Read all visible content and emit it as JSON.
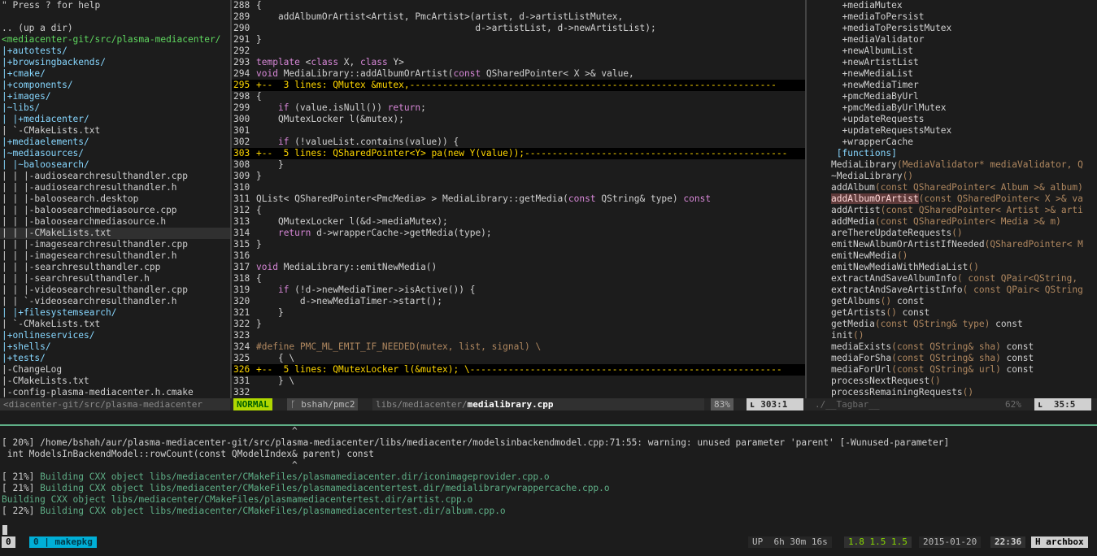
{
  "nerdtree": {
    "lines": [
      {
        "text": "\" Press ? for help",
        "cls": "t-help"
      },
      {
        "text": "",
        "cls": "t-file"
      },
      {
        "text": ".. (up a dir)",
        "cls": "t-up"
      },
      {
        "text": "<mediacenter-git/src/plasma-mediacenter/",
        "cls": "t-root"
      },
      {
        "text": "|+autotests/",
        "cls": "t-dir"
      },
      {
        "text": "|+browsingbackends/",
        "cls": "t-dir"
      },
      {
        "text": "|+cmake/",
        "cls": "t-dir"
      },
      {
        "text": "|+components/",
        "cls": "t-dir"
      },
      {
        "text": "|+images/",
        "cls": "t-dir"
      },
      {
        "text": "|~libs/",
        "cls": "t-dir"
      },
      {
        "text": "| |+mediacenter/",
        "cls": "t-dir"
      },
      {
        "text": "| `-CMakeLists.txt",
        "cls": "t-file"
      },
      {
        "text": "|+mediaelements/",
        "cls": "t-dir"
      },
      {
        "text": "|~mediasources/",
        "cls": "t-dir"
      },
      {
        "text": "| |~baloosearch/",
        "cls": "t-dir"
      },
      {
        "text": "| | |-audiosearchresulthandler.cpp",
        "cls": "t-file"
      },
      {
        "text": "| | |-audiosearchresulthandler.h",
        "cls": "t-file"
      },
      {
        "text": "| | |-baloosearch.desktop",
        "cls": "t-file"
      },
      {
        "text": "| | |-baloosearchmediasource.cpp",
        "cls": "t-file"
      },
      {
        "text": "| | |-baloosearchmediasource.h",
        "cls": "t-file"
      },
      {
        "text": "| | |-CMakeLists.txt",
        "cls": "t-file t-cur"
      },
      {
        "text": "| | |-imagesearchresulthandler.cpp",
        "cls": "t-file"
      },
      {
        "text": "| | |-imagesearchresulthandler.h",
        "cls": "t-file"
      },
      {
        "text": "| | |-searchresulthandler.cpp",
        "cls": "t-file"
      },
      {
        "text": "| | |-searchresulthandler.h",
        "cls": "t-file"
      },
      {
        "text": "| | |-videosearchresulthandler.cpp",
        "cls": "t-file"
      },
      {
        "text": "| | `-videosearchresulthandler.h",
        "cls": "t-file"
      },
      {
        "text": "| |+filesystemsearch/",
        "cls": "t-dir"
      },
      {
        "text": "| `-CMakeLists.txt",
        "cls": "t-file"
      },
      {
        "text": "|+onlineservices/",
        "cls": "t-dir"
      },
      {
        "text": "|+shells/",
        "cls": "t-dir"
      },
      {
        "text": "|+tests/",
        "cls": "t-dir"
      },
      {
        "text": "|-ChangeLog",
        "cls": "t-file"
      },
      {
        "text": "|-CMakeLists.txt",
        "cls": "t-file"
      },
      {
        "text": "|-config-plasma-mediacenter.h.cmake",
        "cls": "t-file"
      }
    ]
  },
  "code": {
    "lines": [
      {
        "n": "288",
        "t": "{",
        "fold": false
      },
      {
        "n": "289",
        "t": "    addAlbumOrArtist<Artist, PmcArtist>(artist, d->artistListMutex,",
        "fold": false
      },
      {
        "n": "290",
        "t": "                                        d->artistList, d->newArtistList);",
        "fold": false
      },
      {
        "n": "291",
        "t": "}",
        "fold": false
      },
      {
        "n": "292",
        "t": "",
        "fold": false
      },
      {
        "n": "293",
        "t": "template <class X, class Y>",
        "fold": false
      },
      {
        "n": "294",
        "t": "void MediaLibrary::addAlbumOrArtist(const QSharedPointer< X >& value,",
        "fold": false
      },
      {
        "n": "295",
        "t": "+--  3 lines: QMutex &mutex,-------------------------------------------------------------------",
        "fold": true
      },
      {
        "n": "298",
        "t": "{",
        "fold": false
      },
      {
        "n": "299",
        "t": "    if (value.isNull()) return;",
        "fold": false
      },
      {
        "n": "300",
        "t": "    QMutexLocker l(&mutex);",
        "fold": false
      },
      {
        "n": "301",
        "t": "",
        "fold": false
      },
      {
        "n": "302",
        "t": "    if (!valueList.contains(value)) {",
        "fold": false
      },
      {
        "n": "303",
        "t": "+--  5 lines: QSharedPointer<Y> pa(new Y(value));------------------------------------------------",
        "fold": true
      },
      {
        "n": "308",
        "t": "    }",
        "fold": false
      },
      {
        "n": "309",
        "t": "}",
        "fold": false
      },
      {
        "n": "310",
        "t": "",
        "fold": false
      },
      {
        "n": "311",
        "t": "QList< QSharedPointer<PmcMedia> > MediaLibrary::getMedia(const QString& type) const",
        "fold": false
      },
      {
        "n": "312",
        "t": "{",
        "fold": false
      },
      {
        "n": "313",
        "t": "    QMutexLocker l(&d->mediaMutex);",
        "fold": false
      },
      {
        "n": "314",
        "t": "    return d->wrapperCache->getMedia(type);",
        "fold": false
      },
      {
        "n": "315",
        "t": "}",
        "fold": false
      },
      {
        "n": "316",
        "t": "",
        "fold": false
      },
      {
        "n": "317",
        "t": "void MediaLibrary::emitNewMedia()",
        "fold": false
      },
      {
        "n": "318",
        "t": "{",
        "fold": false
      },
      {
        "n": "319",
        "t": "    if (!d->newMediaTimer->isActive()) {",
        "fold": false
      },
      {
        "n": "320",
        "t": "        d->newMediaTimer->start();",
        "fold": false
      },
      {
        "n": "321",
        "t": "    }",
        "fold": false
      },
      {
        "n": "322",
        "t": "}",
        "fold": false
      },
      {
        "n": "323",
        "t": "",
        "fold": false
      },
      {
        "n": "324",
        "t": "#define PMC_ML_EMIT_IF_NEEDED(mutex, list, signal) \\",
        "fold": false
      },
      {
        "n": "325",
        "t": "    { \\",
        "fold": false
      },
      {
        "n": "326",
        "t": "+--  5 lines: QMutexLocker l(&mutex); \\---------------------------------------------------------",
        "fold": true
      },
      {
        "n": "331",
        "t": "    } \\",
        "fold": false
      },
      {
        "n": "332",
        "t": "",
        "fold": false
      }
    ]
  },
  "tagbar": {
    "lines": [
      {
        "t": "  +mediaMutex",
        "cls": "tg-var"
      },
      {
        "t": "  +mediaToPersist",
        "cls": "tg-var"
      },
      {
        "t": "  +mediaToPersistMutex",
        "cls": "tg-var"
      },
      {
        "t": "  +mediaValidator",
        "cls": "tg-var"
      },
      {
        "t": "  +newAlbumList",
        "cls": "tg-var"
      },
      {
        "t": "  +newArtistList",
        "cls": "tg-var"
      },
      {
        "t": "  +newMediaList",
        "cls": "tg-var"
      },
      {
        "t": "  +newMediaTimer",
        "cls": "tg-var"
      },
      {
        "t": "  +pmcMediaByUrl",
        "cls": "tg-var"
      },
      {
        "t": "  +pmcMediaByUrlMutex",
        "cls": "tg-var"
      },
      {
        "t": "  +updateRequests",
        "cls": "tg-var"
      },
      {
        "t": "  +updateRequestsMutex",
        "cls": "tg-var"
      },
      {
        "t": "  +wrapperCache",
        "cls": "tg-var"
      },
      {
        "t": " [functions]",
        "cls": "tg-kind"
      },
      {
        "t": "MediaLibrary",
        "sig": "(MediaValidator* mediaValidator, Q",
        "cls": "tg-fn"
      },
      {
        "t": "~MediaLibrary",
        "sig": "()",
        "cls": "tg-fn"
      },
      {
        "t": "addAlbum",
        "sig": "(const QSharedPointer< Album >& album)",
        "cls": "tg-fn"
      },
      {
        "t": "addAlbumOrArtist",
        "sig": "(const QSharedPointer< X >& va",
        "cls": "tg-fn",
        "hl": true
      },
      {
        "t": "addArtist",
        "sig": "(const QSharedPointer< Artist >& arti",
        "cls": "tg-fn"
      },
      {
        "t": "addMedia",
        "sig": "(const QSharedPointer< Media >& m)",
        "cls": "tg-fn"
      },
      {
        "t": "areThereUpdateRequests",
        "sig": "()",
        "cls": "tg-fn"
      },
      {
        "t": "emitNewAlbumOrArtistIfNeeded",
        "sig": "(QSharedPointer< M",
        "cls": "tg-fn"
      },
      {
        "t": "emitNewMedia",
        "sig": "()",
        "cls": "tg-fn"
      },
      {
        "t": "emitNewMediaWithMediaList",
        "sig": "()",
        "cls": "tg-fn"
      },
      {
        "t": "extractAndSaveAlbumInfo",
        "sig": "( const QPair<QString,",
        "cls": "tg-fn"
      },
      {
        "t": "extractAndSaveArtistInfo",
        "sig": "( const QPair< QString",
        "cls": "tg-fn"
      },
      {
        "t": "getAlbums",
        "sig": "() const",
        "cls": "tg-fn"
      },
      {
        "t": "getArtists",
        "sig": "() const",
        "cls": "tg-fn"
      },
      {
        "t": "getMedia",
        "sig": "(const QString& type) const",
        "cls": "tg-fn"
      },
      {
        "t": "init",
        "sig": "()",
        "cls": "tg-fn"
      },
      {
        "t": "mediaExists",
        "sig": "(const QString& sha) const",
        "cls": "tg-fn"
      },
      {
        "t": "mediaForSha",
        "sig": "(const QString& sha) const",
        "cls": "tg-fn"
      },
      {
        "t": "mediaForUrl",
        "sig": "(const QString& url) const",
        "cls": "tg-fn"
      },
      {
        "t": "processNextRequest",
        "sig": "()",
        "cls": "tg-fn"
      },
      {
        "t": "processRemainingRequests",
        "sig": "()",
        "cls": "tg-fn"
      }
    ]
  },
  "statusline": {
    "tree_path": "<diacenter-git/src/plasma-mediacenter",
    "mode": "NORMAL",
    "branch": "ᚴ bshah/pmc2",
    "path_dir": "libs/mediacenter/",
    "path_file": "medialibrary.cpp",
    "percent": "83%",
    "position": "ʟ 303:1",
    "tagbar_name": "./__Tagbar__",
    "tagbar_percent": "62%",
    "tagbar_position": "ʟ  35:5"
  },
  "output": {
    "lines": [
      {
        "t": "                                                     ^",
        "cls": "o-white"
      },
      {
        "t": "[ 20%] /home/bshah/aur/plasma-mediacenter-git/src/plasma-mediacenter/libs/mediacenter/modelsinbackendmodel.cpp:71:55: warning: unused parameter 'parent' [-Wunused-parameter]",
        "cls": "o-white"
      },
      {
        "t": " int ModelsInBackendModel::rowCount(const QModelIndex& parent) const",
        "cls": "o-white"
      },
      {
        "t": "                                                     ^",
        "cls": "o-white"
      },
      {
        "t": "[ 21%] Building CXX object libs/mediacenter/CMakeFiles/plasmamediacenter.dir/iconimageprovider.cpp.o",
        "cls": "o-mixed"
      },
      {
        "t": "[ 21%] Building CXX object libs/mediacenter/CMakeFiles/plasmamediacentertest.dir/medialibrarywrappercache.cpp.o",
        "cls": "o-mixed"
      },
      {
        "t": "Building CXX object libs/mediacenter/CMakeFiles/plasmamediacentertest.dir/artist.cpp.o",
        "cls": "o-green"
      },
      {
        "t": "[ 22%] Building CXX object libs/mediacenter/CMakeFiles/plasmamediacentertest.dir/album.cpp.o",
        "cls": "o-mixed"
      }
    ]
  },
  "tmux": {
    "session": "0",
    "window": "0 | makepkg",
    "uptime": "UP  6h 30m 16s",
    "load": "1.8 1.5 1.5",
    "date": "2015-01-20",
    "time": "22:36",
    "host": "H archbox"
  }
}
